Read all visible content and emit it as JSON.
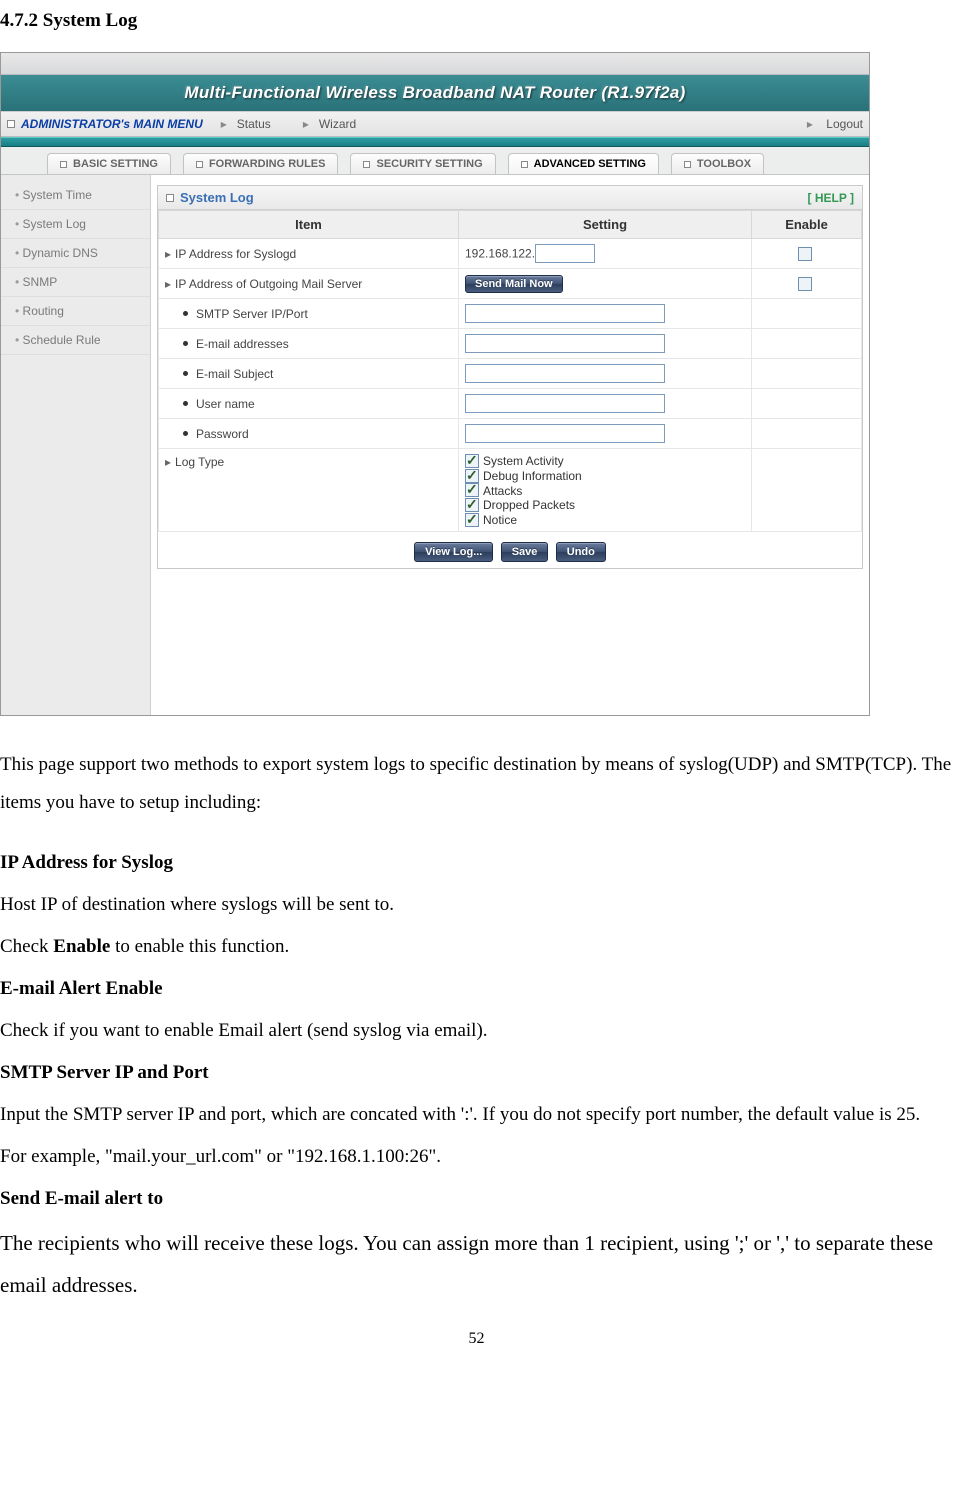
{
  "doc": {
    "heading": "4.7.2 System Log",
    "page_number": "52",
    "paragraphs": {
      "intro": "This page support two methods to export system logs to specific destination by means of syslog(UDP) and SMTP(TCP). The items you have to setup including:",
      "h_ip": "IP Address for Syslog",
      "ip1": "Host IP of destination where syslogs will be sent to.",
      "ip2_pre": "Check ",
      "ip2_bold": "Enable",
      "ip2_post": " to enable this function.",
      "h_email": "E-mail Alert Enable",
      "email1": "Check if you want to enable Email alert (send syslog via email).",
      "h_smtp": "SMTP Server IP and Port",
      "smtp1": "Input the SMTP server IP and port, which are concated with ':'. If you do not specify port number, the default value is 25.",
      "smtp2": "For example, \"mail.your_url.com\" or \"192.168.1.100:26\".",
      "h_send": "Send E-mail alert to",
      "send1": "The recipients who will receive these logs. You can assign more than 1 recipient, using ';' or ',' to separate these email addresses."
    }
  },
  "router": {
    "banner": "Multi-Functional Wireless Broadband NAT Router (R1.97f2a)",
    "admin": {
      "title": "ADMINISTRATOR's MAIN MENU",
      "status": "Status",
      "wizard": "Wizard",
      "logout": "Logout"
    },
    "tabs": {
      "basic": "BASIC SETTING",
      "forward": "FORWARDING RULES",
      "security": "SECURITY SETTING",
      "advanced": "ADVANCED SETTING",
      "toolbox": "TOOLBOX"
    },
    "sidebar": [
      "System Time",
      "System Log",
      "Dynamic DNS",
      "SNMP",
      "Routing",
      "Schedule Rule"
    ],
    "panel": {
      "title": "System Log",
      "help": "[ HELP ]",
      "headers": {
        "item": "Item",
        "setting": "Setting",
        "enable": "Enable"
      },
      "rows": {
        "syslog_label": "IP Address for Syslogd",
        "syslog_prefix": "192.168.122.",
        "mail_label": "IP Address of Outgoing Mail Server",
        "mail_btn": "Send Mail Now",
        "smtp": "SMTP Server IP/Port",
        "emails": "E-mail addresses",
        "subject": "E-mail Subject",
        "user": "User name",
        "pass": "Password",
        "logtype": "Log Type",
        "lt1": "System Activity",
        "lt2": "Debug Information",
        "lt3": "Attacks",
        "lt4": "Dropped Packets",
        "lt5": "Notice"
      },
      "actions": {
        "view": "View Log...",
        "save": "Save",
        "undo": "Undo"
      }
    }
  }
}
